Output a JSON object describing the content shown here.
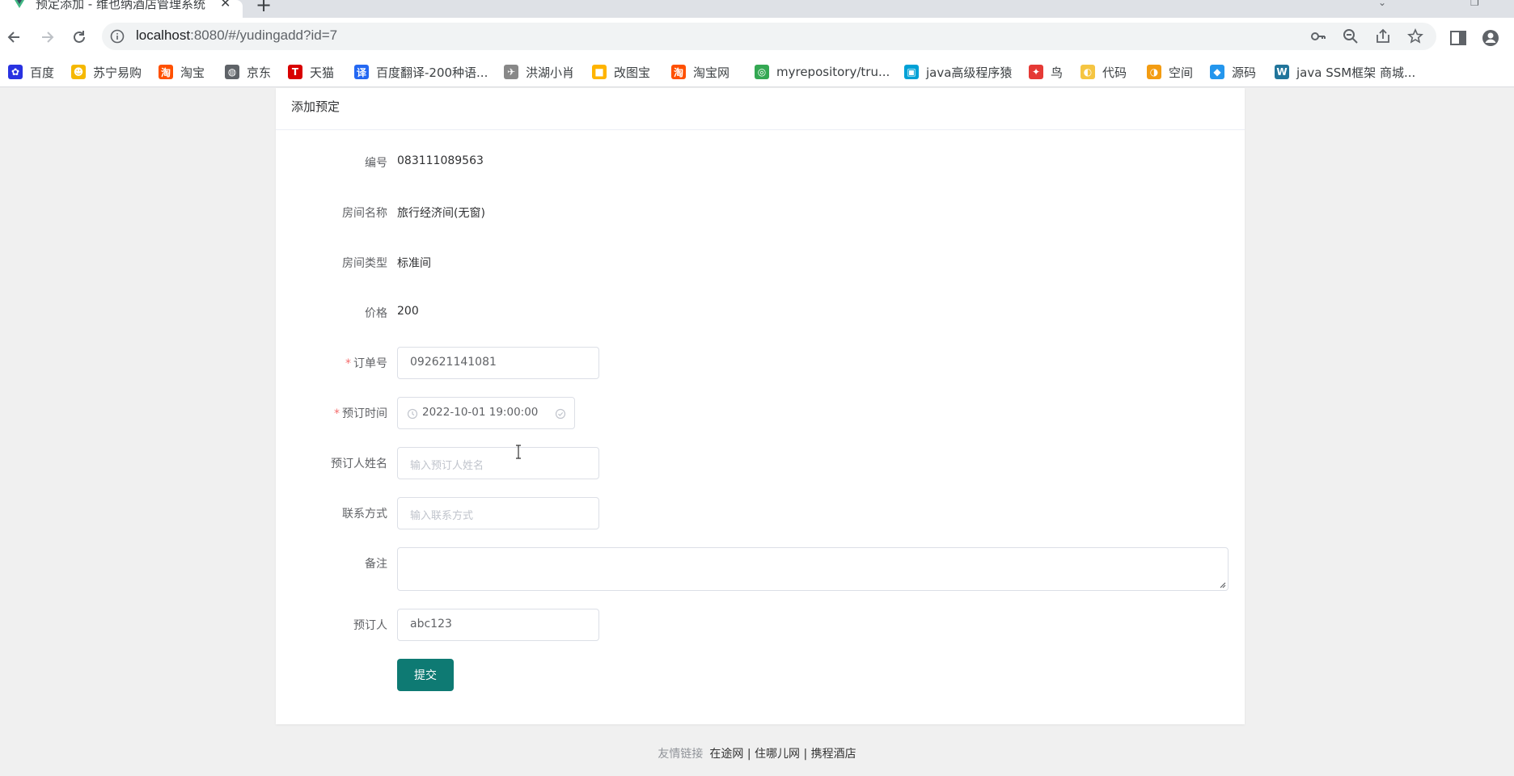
{
  "browser": {
    "tab_title": "预定添加 - 维也纳酒店管理系统",
    "url_host": "localhost",
    "url_path": ":8080/#/yudingadd?id=7"
  },
  "bookmarks": [
    {
      "label": "百度",
      "icon": "baidu-icon",
      "color": "#2932e1"
    },
    {
      "label": "苏宁易购",
      "icon": "suning-icon",
      "color": "#f5b800"
    },
    {
      "label": "淘宝",
      "icon": "taobao-icon",
      "color": "#ff5000"
    },
    {
      "label": "京东",
      "icon": "globe-icon",
      "color": "#5f6368"
    },
    {
      "label": "天猫",
      "icon": "tmall-icon",
      "color": "#d80000"
    },
    {
      "label": "百度翻译-200种语...",
      "icon": "baidu-translate-icon",
      "color": "#2468f2"
    },
    {
      "label": "洪湖小肖",
      "icon": "bird-icon",
      "color": "#888888"
    },
    {
      "label": "改图宝",
      "icon": "gaitubao-icon",
      "color": "#ffb400"
    },
    {
      "label": "淘宝网",
      "icon": "taobao-icon",
      "color": "#ff5000"
    },
    {
      "label": "myrepository/tru...",
      "icon": "chrome-icon",
      "color": "#34a853"
    },
    {
      "label": "java高级程序猿",
      "icon": "bilibili-icon",
      "color": "#00a1d6"
    },
    {
      "label": "鸟",
      "icon": "bird-red-icon",
      "color": "#e53935"
    },
    {
      "label": "代码",
      "icon": "code-icon",
      "color": "#f5c542"
    },
    {
      "label": "空间",
      "icon": "qzone-icon",
      "color": "#f39c12"
    },
    {
      "label": "源码",
      "icon": "docker-icon",
      "color": "#2496ed"
    },
    {
      "label": "java SSM框架 商城...",
      "icon": "wordpress-icon",
      "color": "#21759b"
    }
  ],
  "card": {
    "title": "添加预定"
  },
  "form": {
    "bianhao": {
      "label": "编号",
      "value": "083111089563"
    },
    "fangjianmingcheng": {
      "label": "房间名称",
      "value": "旅行经济间(无窗)"
    },
    "fangjianleixing": {
      "label": "房间类型",
      "value": "标准间"
    },
    "jiage": {
      "label": "价格",
      "value": "200"
    },
    "dingdanhao": {
      "label": "订单号",
      "required": "*",
      "value": "092621141081"
    },
    "yudingshijian": {
      "label": "预订时间",
      "required": "*",
      "value": "2022-10-01 19:00:00"
    },
    "yudingrenxingming": {
      "label": "预订人姓名",
      "placeholder": "输入预订人姓名"
    },
    "lianxifangshi": {
      "label": "联系方式",
      "placeholder": "输入联系方式"
    },
    "beizhu": {
      "label": "备注",
      "value": ""
    },
    "yudingren": {
      "label": "预订人",
      "value": "abc123"
    },
    "submit_label": "提交"
  },
  "footer": {
    "prefix": "友情链接",
    "links": [
      "在途网",
      "住哪儿网",
      "携程酒店"
    ],
    "separator": " | "
  },
  "colors": {
    "primary": "#0e7a73",
    "required": "#f56c6c"
  }
}
